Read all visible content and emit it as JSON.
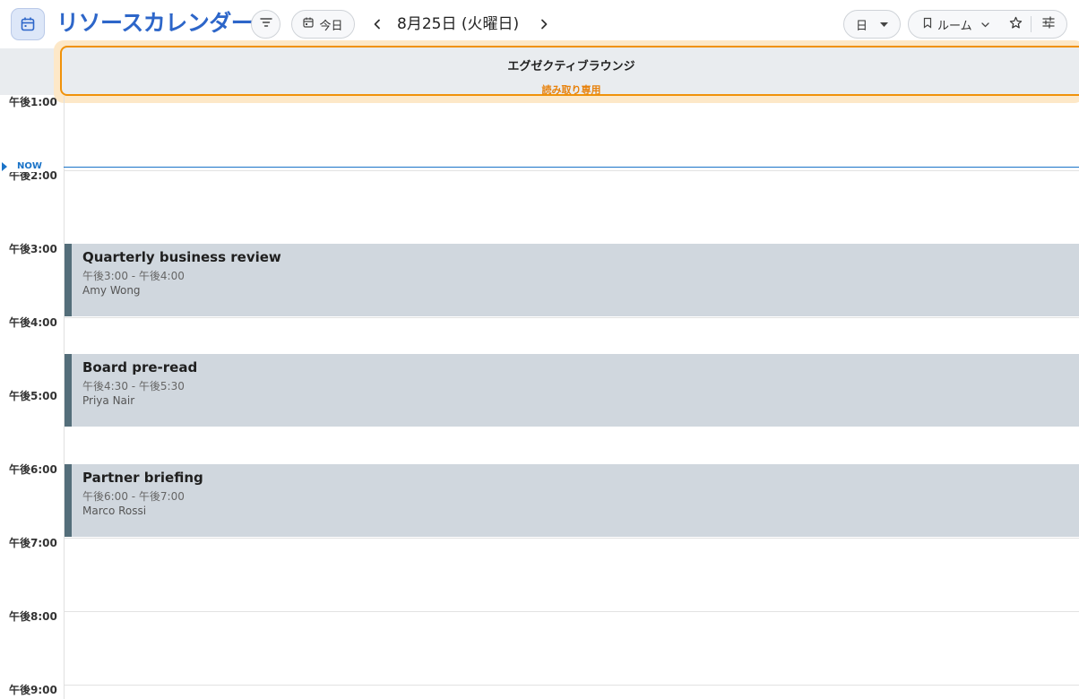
{
  "app": {
    "title": "リソースカレンダー"
  },
  "toolbar": {
    "today_label": "今日",
    "date_label": "8月25日 (火曜日)",
    "view_label": "日",
    "room_label": "ルーム"
  },
  "resource": {
    "name": "エグゼクティブラウンジ",
    "status": "読み取り専用"
  },
  "now_label": "NOW",
  "time_labels": [
    "午後1:00",
    "午後2:00",
    "午後3:00",
    "午後4:00",
    "午後5:00",
    "午後6:00",
    "午後7:00",
    "午後8:00",
    "午後9:00"
  ],
  "events": [
    {
      "title": "Quarterly business review",
      "time": "午後3:00 - 午後4:00",
      "organizer": "Amy Wong"
    },
    {
      "title": "Board pre-read",
      "time": "午後4:30 - 午後5:30",
      "organizer": "Priya Nair"
    },
    {
      "title": "Partner briefing",
      "time": "午後6:00 - 午後7:00",
      "organizer": "Marco Rossi"
    }
  ],
  "colors": {
    "accent": "#2d66c9",
    "now_line": "#1a73c8",
    "read_only": "#e8820c",
    "event_bg": "#d0d7de",
    "event_bar": "#546e7a"
  }
}
